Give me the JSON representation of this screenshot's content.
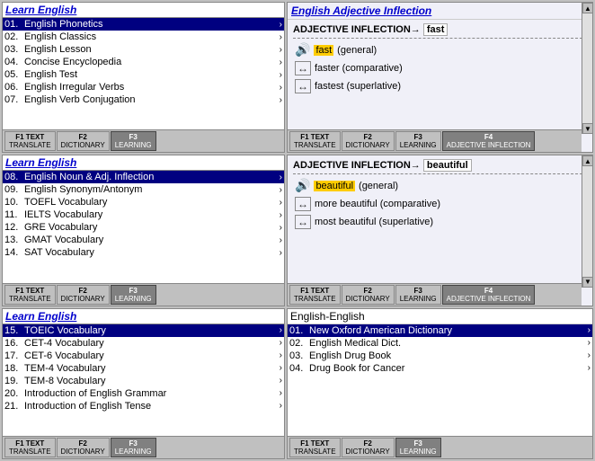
{
  "app": {
    "title": "Learn English"
  },
  "left_panels": [
    {
      "id": "panel1",
      "header": "Learn English",
      "items": [
        {
          "num": "01.",
          "text": "English Phonetics",
          "selected": true
        },
        {
          "num": "02.",
          "text": "English Classics",
          "selected": false
        },
        {
          "num": "03.",
          "text": "English Lesson",
          "selected": false
        },
        {
          "num": "04.",
          "text": "Concise Encyclopedia",
          "selected": false
        },
        {
          "num": "05.",
          "text": "English Test",
          "selected": false
        },
        {
          "num": "06.",
          "text": "English Irregular Verbs",
          "selected": false
        },
        {
          "num": "07.",
          "text": "English Verb Conjugation",
          "selected": false
        }
      ],
      "toolbar": [
        {
          "label_top": "TEXT",
          "label_bottom": "TRANSLATE",
          "key": "F1",
          "active": false
        },
        {
          "label_top": "F2",
          "label_bottom": "DICTIONARY",
          "key": "F2",
          "active": false
        },
        {
          "label_top": "F3",
          "label_bottom": "LEARNING",
          "key": "F3",
          "active": true
        }
      ]
    },
    {
      "id": "panel2",
      "header": "Learn English",
      "items": [
        {
          "num": "08.",
          "text": "English Noun & Adj. Inflection",
          "selected": true
        },
        {
          "num": "09.",
          "text": "English Synonym/Antonym",
          "selected": false
        },
        {
          "num": "10.",
          "text": "TOEFL Vocabulary",
          "selected": false
        },
        {
          "num": "11.",
          "text": "IELTS Vocabulary",
          "selected": false
        },
        {
          "num": "12.",
          "text": "GRE Vocabulary",
          "selected": false
        },
        {
          "num": "13.",
          "text": "GMAT Vocabulary",
          "selected": false
        },
        {
          "num": "14.",
          "text": "SAT Vocabulary",
          "selected": false
        }
      ],
      "toolbar": [
        {
          "label_top": "TEXT",
          "label_bottom": "TRANSLATE",
          "key": "F1",
          "active": false
        },
        {
          "label_top": "F2",
          "label_bottom": "DICTIONARY",
          "key": "F2",
          "active": false
        },
        {
          "label_top": "F3",
          "label_bottom": "LEARNING",
          "key": "F3",
          "active": true
        }
      ]
    },
    {
      "id": "panel3",
      "header": "Learn English",
      "items": [
        {
          "num": "15.",
          "text": "TOEIC Vocabulary",
          "selected": true
        },
        {
          "num": "16.",
          "text": "CET-4 Vocabulary",
          "selected": false
        },
        {
          "num": "17.",
          "text": "CET-6 Vocabulary",
          "selected": false
        },
        {
          "num": "18.",
          "text": "TEM-4 Vocabulary",
          "selected": false
        },
        {
          "num": "19.",
          "text": "TEM-8 Vocabulary",
          "selected": false
        },
        {
          "num": "20.",
          "text": "Introduction of English Grammar",
          "selected": false
        },
        {
          "num": "21.",
          "text": "Introduction of English Tense",
          "selected": false
        }
      ],
      "toolbar": [
        {
          "label_top": "TEXT",
          "label_bottom": "TRANSLATE",
          "key": "F1",
          "active": false
        },
        {
          "label_top": "F2",
          "label_bottom": "DICTIONARY",
          "key": "F2",
          "active": false
        },
        {
          "label_top": "F3",
          "label_bottom": "LEARNING",
          "key": "F3",
          "active": true
        }
      ]
    }
  ],
  "right_panels": [
    {
      "id": "adj1",
      "section_title": "English Adjective Inflection",
      "title_prefix": "ADJECTIVE INFLECTION→",
      "title_word": "fast",
      "items": [
        {
          "icon": "🔊",
          "text": "fast (general)",
          "highlighted": true,
          "highlight_word": "fast"
        },
        {
          "icon": "↔",
          "text": "faster (comparative)",
          "highlighted": false
        },
        {
          "icon": "↔",
          "text": "fastest (superlative)",
          "highlighted": false
        }
      ],
      "toolbar": [
        {
          "label_top": "TEXT",
          "label_bottom": "TRANSLATE",
          "key": "F1",
          "active": false
        },
        {
          "label_top": "F2",
          "label_bottom": "DICTIONARY",
          "key": "F2",
          "active": false
        },
        {
          "label_top": "F3",
          "label_bottom": "LEARNING",
          "key": "F3",
          "active": false
        },
        {
          "label_top": "F4",
          "label_bottom": "ADJECTIVE INFLECTION",
          "key": "F4",
          "active": true
        }
      ]
    },
    {
      "id": "adj2",
      "section_title": "",
      "title_prefix": "ADJECTIVE INFLECTION→",
      "title_word": "beautiful",
      "items": [
        {
          "icon": "🔊",
          "text": "beautiful (general)",
          "highlighted": true,
          "highlight_word": "beautiful"
        },
        {
          "icon": "↔",
          "text": "more beautiful (comparative)",
          "highlighted": false
        },
        {
          "icon": "↔",
          "text": "most beautiful (superlative)",
          "highlighted": false
        }
      ],
      "toolbar": [
        {
          "label_top": "TEXT",
          "label_bottom": "TRANSLATE",
          "key": "F1",
          "active": false
        },
        {
          "label_top": "F2",
          "label_bottom": "DICTIONARY",
          "key": "F2",
          "active": false
        },
        {
          "label_top": "F3",
          "label_bottom": "LEARNING",
          "key": "F3",
          "active": false
        },
        {
          "label_top": "F4",
          "label_bottom": "ADJECTIVE INFLECTION",
          "key": "F4",
          "active": true
        }
      ]
    }
  ],
  "english_english": {
    "header": "English-English",
    "items": [
      {
        "num": "01.",
        "text": "New Oxford American Dictionary",
        "selected": true
      },
      {
        "num": "02.",
        "text": "English Medical Dict.",
        "selected": false
      },
      {
        "num": "03.",
        "text": "English Drug Book",
        "selected": false
      },
      {
        "num": "04.",
        "text": "Drug Book for Cancer",
        "selected": false
      }
    ],
    "toolbar": [
      {
        "label_top": "TEXT",
        "label_bottom": "TRANSLATE",
        "key": "F1",
        "active": false
      },
      {
        "label_top": "F2",
        "label_bottom": "DICTIONARY",
        "key": "F2",
        "active": false
      },
      {
        "label_top": "F3",
        "label_bottom": "LEARNING",
        "key": "F3",
        "active": true
      }
    ]
  },
  "colors": {
    "selected_bg": "#000080",
    "selected_text": "#ffffff",
    "header_text": "#0000cc",
    "active_btn_bg": "#404040",
    "adj_bg": "#e8e8e8"
  }
}
